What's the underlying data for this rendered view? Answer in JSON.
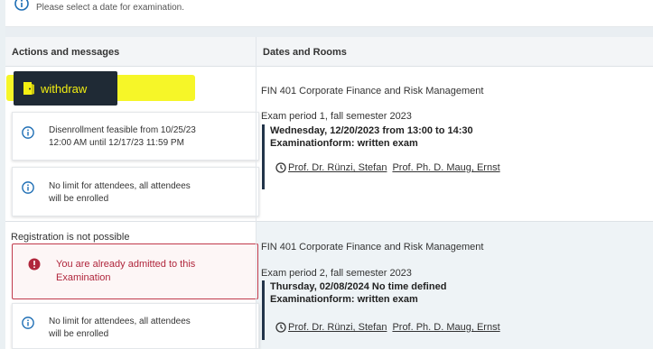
{
  "notice": {
    "text": "Please select a date for examination."
  },
  "table": {
    "col1_header": "Actions and messages",
    "col2_header": "Dates and Rooms"
  },
  "rows": [
    {
      "action_button": "withdraw",
      "messages": [
        {
          "line1": "Disenrollment feasible from 10/25/23",
          "line2": "12:00 AM until 12/17/23 11:59 PM"
        },
        {
          "line1": "No limit for attendees, all attendees",
          "line2": "will be enrolled"
        }
      ],
      "course": "FIN 401 Corporate Finance and Risk Management",
      "period": "Exam period 1, fall semester 2023",
      "date_line": "Wednesday, 12/20/2023 from 13:00 to 14:30",
      "form_line": "Examinationform: written exam",
      "profs": [
        "Prof. Dr. Rünzi, Stefan",
        "Prof. Ph. D. Maug, Ernst"
      ]
    },
    {
      "status": "Registration is not possible",
      "error": {
        "line1": "You are already admitted to this",
        "line2": "Examination"
      },
      "messages": [
        {
          "line1": "No limit for attendees, all attendees",
          "line2": "will be enrolled"
        }
      ],
      "course": "FIN 401 Corporate Finance and Risk Management",
      "period": "Exam period 2, fall semester 2023",
      "date_line": "Thursday, 02/08/2024 No time defined",
      "form_line": "Examinationform: written exam",
      "profs": [
        "Prof. Dr. Rünzi, Stefan",
        "Prof. Ph. D. Maug, Ernst"
      ]
    }
  ],
  "colors": {
    "accent_dark": "#1f2a35",
    "highlight": "#f6f628",
    "error": "#c0394b",
    "info": "#1f6fb5"
  },
  "icons": [
    "info-icon",
    "door-exit-icon",
    "error-icon",
    "clock-icon"
  ]
}
